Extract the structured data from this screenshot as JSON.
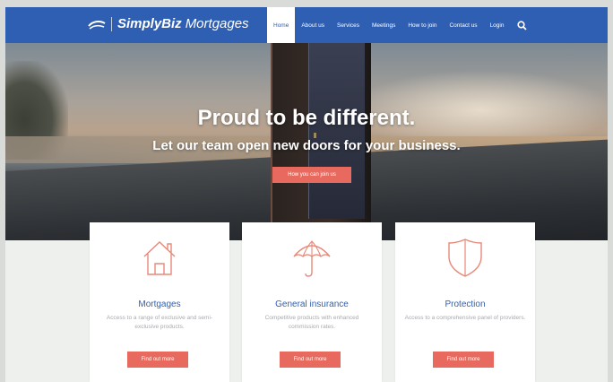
{
  "brand": {
    "bold": "SimplyBiz",
    "light": "Mortgages"
  },
  "nav": {
    "items": [
      {
        "label": "Home"
      },
      {
        "label": "About us"
      },
      {
        "label": "Services"
      },
      {
        "label": "Meetings"
      },
      {
        "label": "How to join"
      },
      {
        "label": "Contact us"
      },
      {
        "label": "Login"
      }
    ],
    "search_icon": "search-icon"
  },
  "hero": {
    "title": "Proud to be different.",
    "subtitle": "Let our team open new doors for your business.",
    "button": "How you can join us"
  },
  "cards": [
    {
      "icon": "house-icon",
      "title": "Mortgages",
      "description": "Access to a range of exclusive and semi- exclusive products.",
      "button": "Find out more"
    },
    {
      "icon": "umbrella-icon",
      "title": "General insurance",
      "description": "Competitive products with enhanced commission rates.",
      "button": "Find out more"
    },
    {
      "icon": "shield-icon",
      "title": "Protection",
      "description": "Access to a comprehensive panel of providers.",
      "button": "Find out more"
    }
  ],
  "colors": {
    "nav_bg": "#2f5fb2",
    "accent": "#e86a5e",
    "card_title": "#2f5fb2",
    "icon_stroke": "#e88878"
  }
}
